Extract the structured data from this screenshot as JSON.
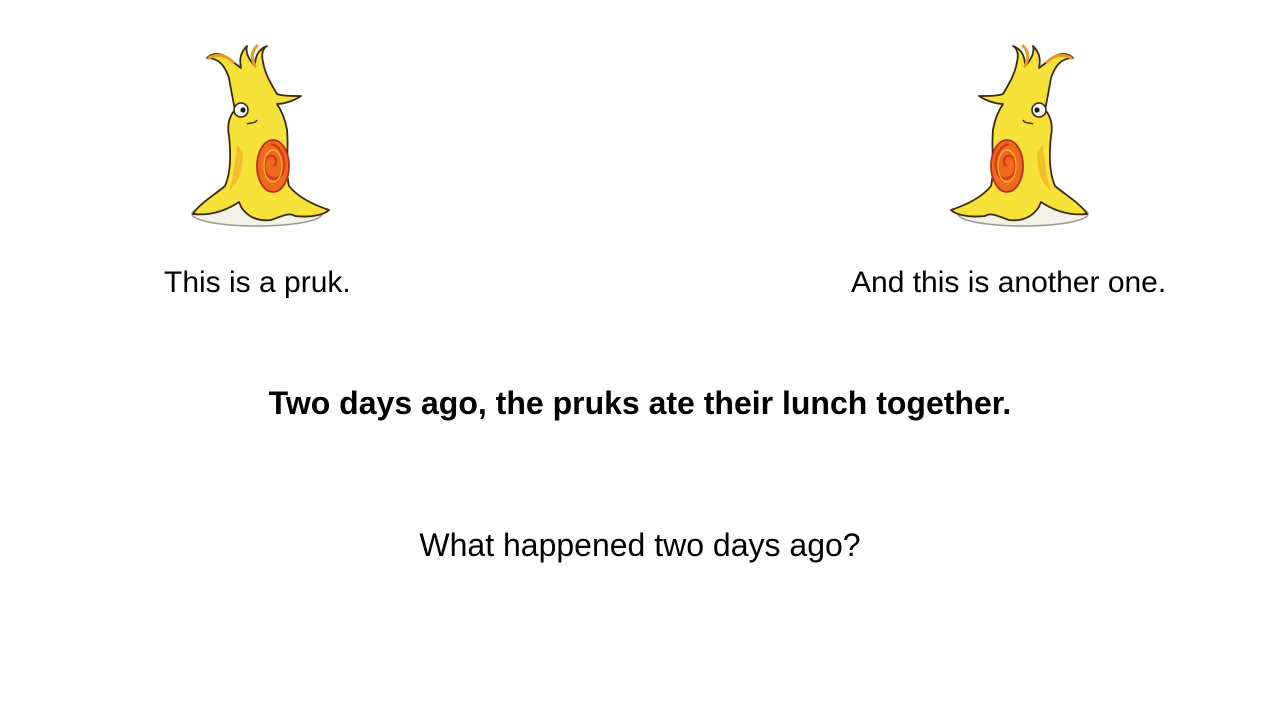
{
  "slide": {
    "creature_left": {
      "icon": "pruk-creature-icon",
      "facing": "right"
    },
    "creature_right": {
      "icon": "pruk-creature-icon",
      "facing": "left"
    },
    "caption_left": "This is a pruk.",
    "caption_right": "And this is another one.",
    "statement": "Two days ago, the pruks ate their lunch together.",
    "question": "What happened two days ago?"
  },
  "colors": {
    "body_yellow": "#f7e23a",
    "body_orange": "#f2a623",
    "spiral_orange": "#ef6a1f",
    "spiral_red": "#d6381a",
    "outline": "#3a2a10"
  }
}
